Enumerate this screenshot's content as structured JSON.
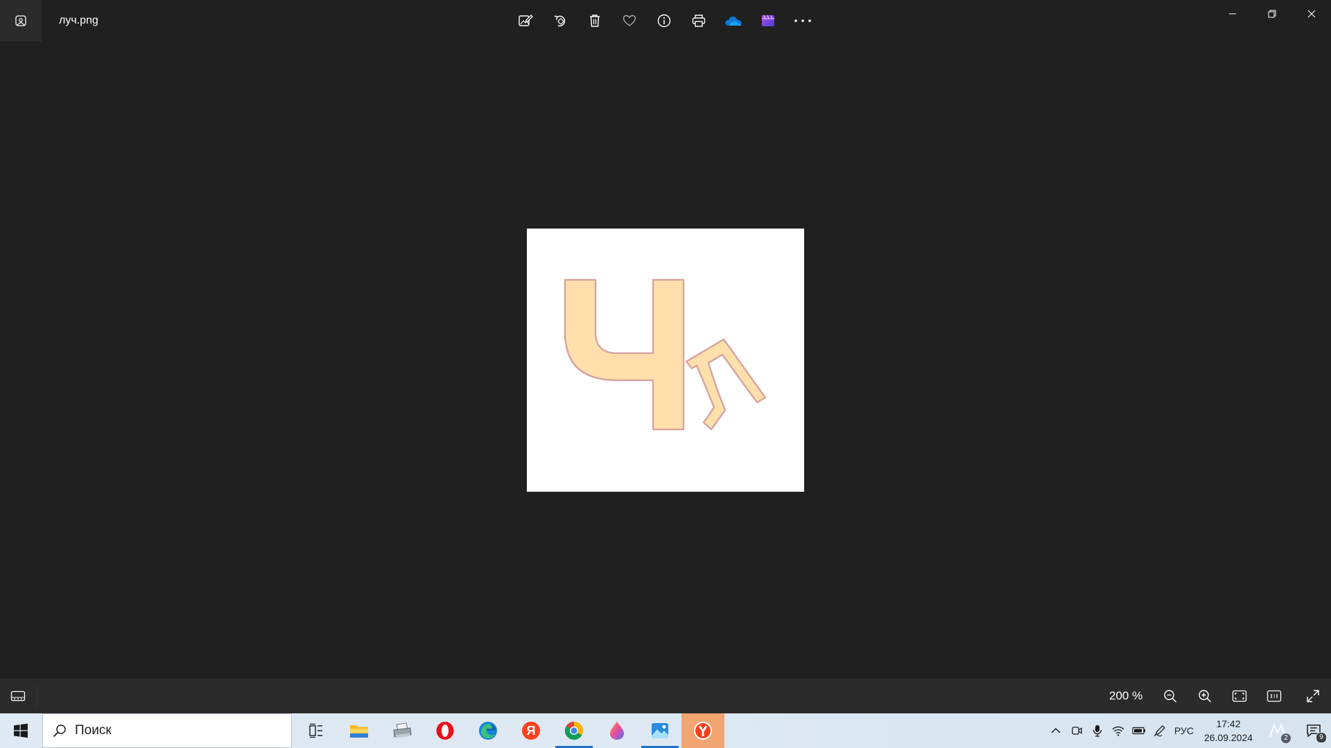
{
  "window": {
    "file_name": "луч.png"
  },
  "toolbar": {
    "buttons": [
      {
        "name": "edit-icon",
        "label": "Изменить"
      },
      {
        "name": "rotate-icon",
        "label": "Повернуть"
      },
      {
        "name": "delete-icon",
        "label": "Удалить"
      },
      {
        "name": "favorite-icon",
        "label": "Избранное"
      },
      {
        "name": "info-icon",
        "label": "Сведения"
      },
      {
        "name": "print-icon",
        "label": "Печать"
      },
      {
        "name": "onedrive-icon",
        "label": "OneDrive"
      },
      {
        "name": "clipchamp-icon",
        "label": "Clipchamp"
      },
      {
        "name": "more-icon",
        "label": "Дополнительно"
      }
    ]
  },
  "image": {
    "depicted_glyph": "Ч",
    "fill_color": "#ffe0ac",
    "stroke_color": "#d7a5a0"
  },
  "statusbar": {
    "zoom": "200 %"
  },
  "taskbar": {
    "search_placeholder": "Поиск",
    "language": "РУС",
    "time": "17:42",
    "date": "26.09.2024",
    "meet_badge": "2",
    "notification_count": "9",
    "apps": [
      {
        "name": "task-view-icon"
      },
      {
        "name": "file-explorer-icon"
      },
      {
        "name": "printer-app-icon"
      },
      {
        "name": "opera-icon"
      },
      {
        "name": "edge-icon"
      },
      {
        "name": "yandex-icon"
      },
      {
        "name": "chrome-icon"
      },
      {
        "name": "paint-drop-icon"
      },
      {
        "name": "photos-icon"
      },
      {
        "name": "yandex-browser-icon"
      }
    ]
  },
  "colors": {
    "background": "#202020",
    "statusbar": "#2b2b2b",
    "taskbar": "#dfe9f3",
    "accent": "#1a73c9",
    "active_task": "#f2a571"
  }
}
